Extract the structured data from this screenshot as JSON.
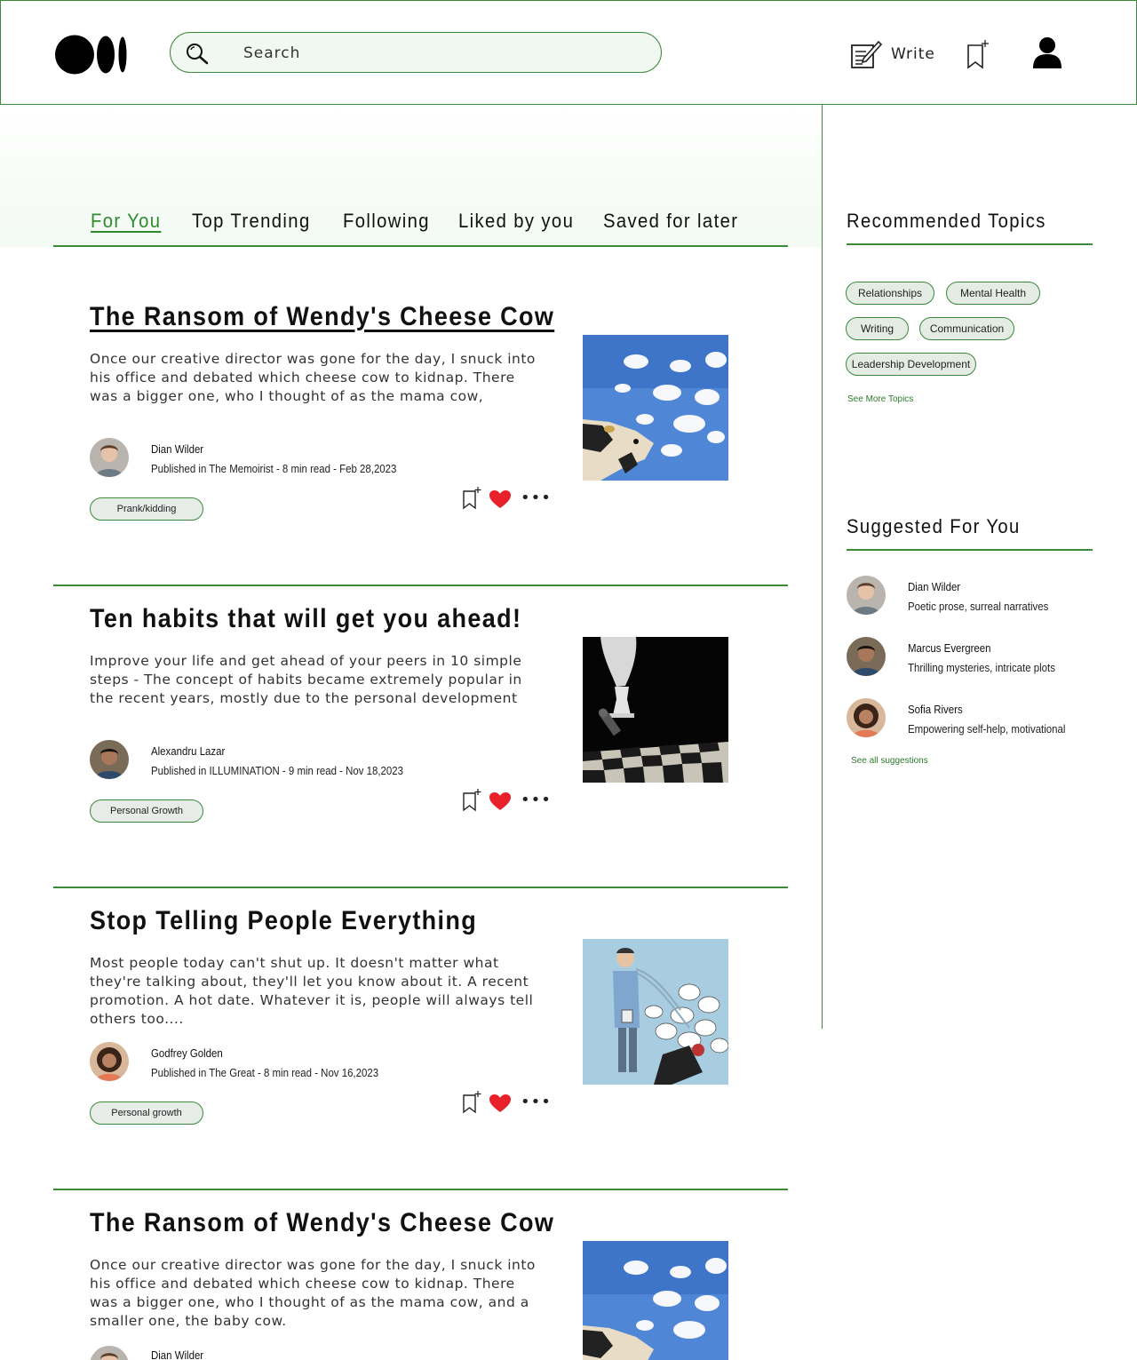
{
  "header": {
    "search_placeholder": "Search",
    "write_label": "Write"
  },
  "tabs": [
    {
      "label": "For You",
      "active": true
    },
    {
      "label": "Top Trending",
      "active": false
    },
    {
      "label": "Following",
      "active": false
    },
    {
      "label": "Liked by you",
      "active": false
    },
    {
      "label": "Saved for later",
      "active": false
    }
  ],
  "articles": [
    {
      "title": "The Ransom of Wendy's Cheese Cow",
      "excerpt": "Once our creative director was gone for the day, I snuck into his office and debated which cheese cow to kidnap. There was a bigger one, who I thought of as the mama cow,",
      "author": "Dian Wilder",
      "meta": "Published in The Memoirist - 8 min read - Feb 28,2023",
      "tag": "Prank/kidding"
    },
    {
      "title": "Ten habits that will get you ahead!",
      "excerpt": "Improve your life and get ahead of your peers in 10 simple steps - The concept of habits became extremely popular in the recent years, mostly due to the personal development",
      "author": "Alexandru Lazar",
      "meta": "Published in ILLUMINATION - 9 min read - Nov 18,2023",
      "tag": "Personal Growth"
    },
    {
      "title": "Stop Telling People Everything",
      "excerpt": "Most people today can't shut up. It doesn't matter what they're talking about, they'll let you know about it. A recent promotion. A hot date. Whatever it is, people will always tell others too....",
      "author": "Godfrey Golden",
      "meta": "Published in The Great - 8 min read - Nov 16,2023",
      "tag": "Personal growth"
    },
    {
      "title": "The Ransom of Wendy's Cheese Cow",
      "excerpt": "Once our creative director was gone for the day, I snuck into his office and debated which cheese cow to kidnap. There was a bigger one, who I thought of as the mama cow, and a smaller one, the baby cow.",
      "author": "Dian Wilder",
      "meta": "",
      "tag": ""
    }
  ],
  "sidebar": {
    "recommended_title": "Recommended Topics",
    "topics": [
      "Relationships",
      "Mental Health",
      "Writing",
      "Communication",
      "Leadership Development"
    ],
    "see_more_topics": "See More Topics",
    "suggested_title": "Suggested For You",
    "suggestions": [
      {
        "name": "Dian Wilder",
        "desc": "Poetic prose, surreal narratives"
      },
      {
        "name": "Marcus Evergreen",
        "desc": "Thrilling mysteries, intricate plots"
      },
      {
        "name": "Sofia Rivers",
        "desc": "Empowering self-help, motivational"
      }
    ],
    "see_all_suggestions": "See all suggestions"
  },
  "colors": {
    "accent": "#3a8a3a",
    "like": "#e8202a"
  }
}
